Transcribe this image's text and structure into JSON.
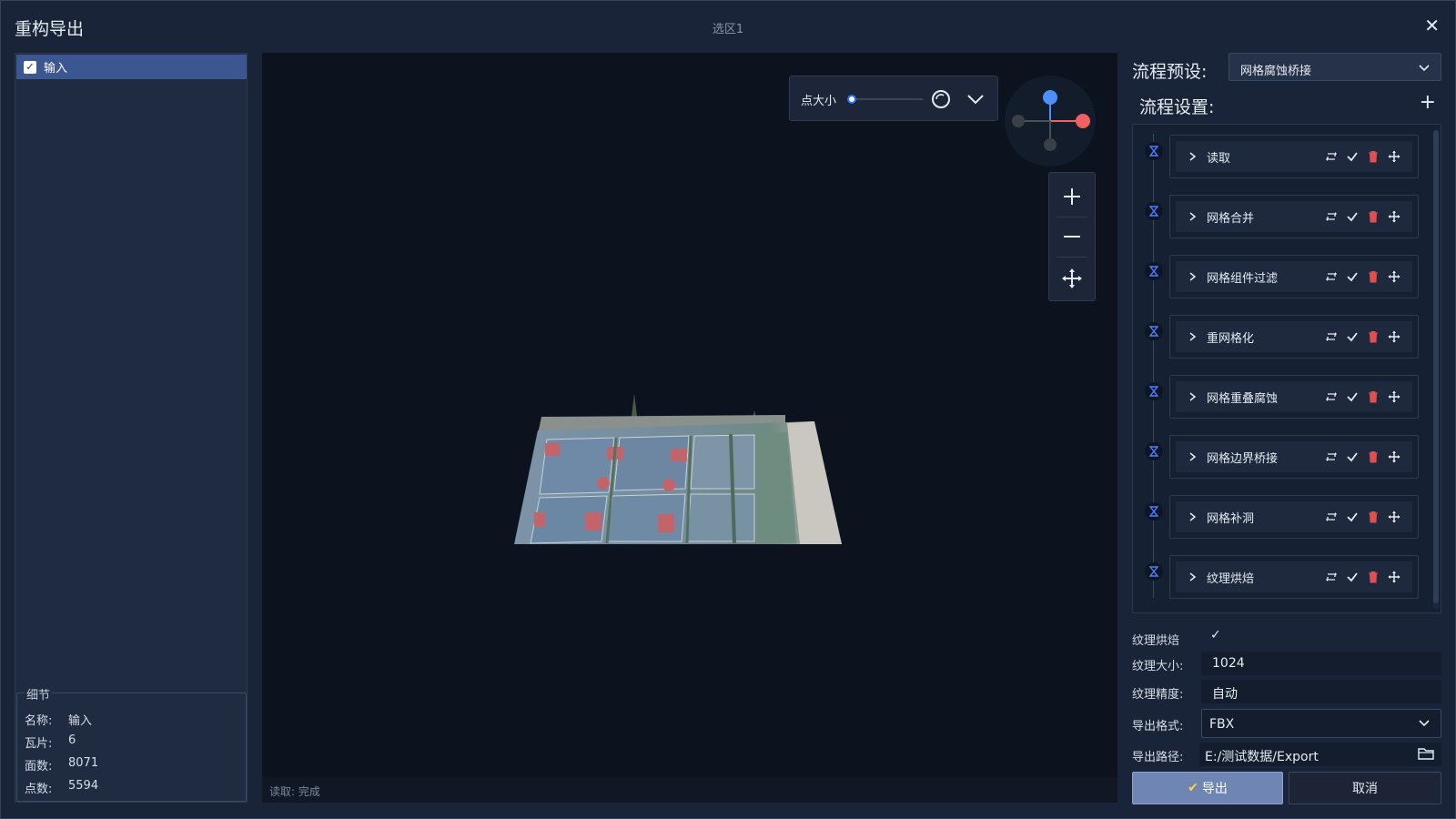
{
  "window": {
    "app_title": "重构导出",
    "title": "选区1",
    "close_icon": "close-icon"
  },
  "tree": {
    "items": [
      {
        "label": "输入",
        "checked": true
      }
    ]
  },
  "details": {
    "title": "细节",
    "rows": [
      {
        "key": "名称:",
        "value": "输入"
      },
      {
        "key": "瓦片:",
        "value": "6"
      },
      {
        "key": "面数:",
        "value": "8071"
      },
      {
        "key": "点数:",
        "value": "5594"
      }
    ]
  },
  "viewport": {
    "status_text": "读取: 完成",
    "point_size_label": "点大小",
    "point_size_fraction": 0.05,
    "gizmo_colors": {
      "y": "#4a90ff",
      "x": "#f06060",
      "neutral": "#4a4f58"
    },
    "zoom_in_icon": "plus-icon",
    "zoom_out_icon": "minus-icon",
    "pan_icon": "move-icon"
  },
  "pipeline": {
    "preset_label": "流程预设:",
    "preset_value": "网格腐蚀桥接",
    "flow_label": "流程设置:",
    "steps": [
      {
        "label": "读取"
      },
      {
        "label": "网格合并"
      },
      {
        "label": "网格组件过滤"
      },
      {
        "label": "重网格化"
      },
      {
        "label": "网格重叠腐蚀"
      },
      {
        "label": "网格边界桥接"
      },
      {
        "label": "网格补洞"
      },
      {
        "label": "纹理烘焙"
      }
    ]
  },
  "form": {
    "texture_bake_label": "纹理烘焙",
    "texture_bake_checked": true,
    "texture_size_label": "纹理大小:",
    "texture_size_value": "1024",
    "texture_precision_label": "纹理精度:",
    "texture_precision_value": "自动",
    "export_format_label": "导出格式:",
    "export_format_value": "FBX",
    "export_path_label": "导出路径:",
    "export_path_value": "E:/测试数据/Export"
  },
  "buttons": {
    "export": "导出",
    "cancel": "取消"
  },
  "colors": {
    "background": "#1a2438",
    "viewport": "#0c131f",
    "accent": "#4a90ff",
    "delete": "#e05050",
    "selection": "#3b5690",
    "export_button": "#6f86b5"
  }
}
